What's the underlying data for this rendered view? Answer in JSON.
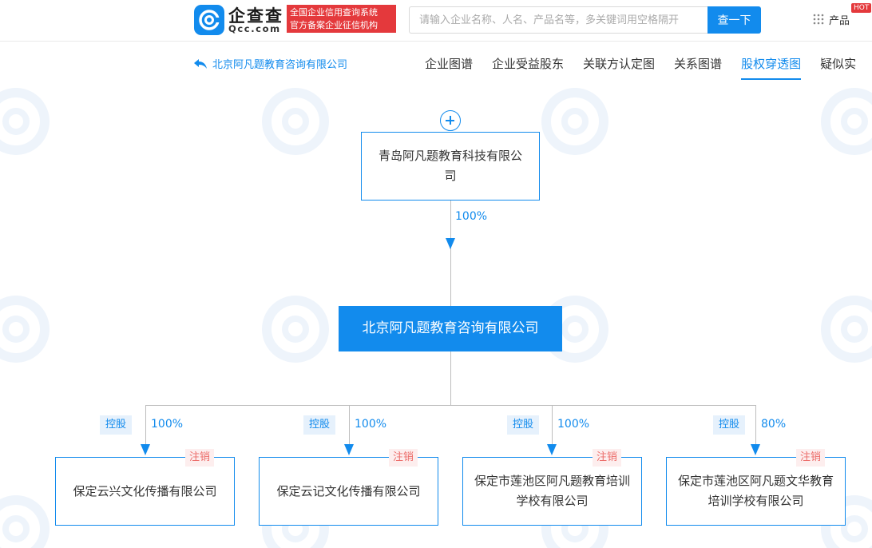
{
  "header": {
    "logo_cn": "企查查",
    "logo_en": "Qcc.com",
    "badge_line1": "全国企业信用查询系统",
    "badge_line2": "官方备案企业征信机构",
    "search_placeholder": "请输入企业名称、人名、产品名等，多关键词用空格隔开",
    "search_button": "查一下",
    "products_label": "产品",
    "hot_label": "HOT"
  },
  "nav": {
    "back_label": "北京阿凡题教育咨询有限公司",
    "tabs": [
      "企业图谱",
      "企业受益股东",
      "关联方认定图",
      "关系图谱",
      "股权穿透图",
      "疑似实"
    ]
  },
  "tree": {
    "parent": {
      "name": "青岛阿凡题教育科技有限公司",
      "pct": "100%"
    },
    "root": {
      "name": "北京阿凡题教育咨询有限公司"
    },
    "children": [
      {
        "name": "保定云兴文化传播有限公司",
        "pct": "100%",
        "type": "控股",
        "status": "注销"
      },
      {
        "name": "保定云记文化传播有限公司",
        "pct": "100%",
        "type": "控股",
        "status": "注销"
      },
      {
        "name": "保定市莲池区阿凡题教育培训学校有限公司",
        "pct": "100%",
        "type": "控股",
        "status": "注销"
      },
      {
        "name": "保定市莲池区阿凡题文华教育培训学校有限公司",
        "pct": "80%",
        "type": "控股",
        "status": "注销"
      }
    ]
  },
  "colors": {
    "accent": "#128bed",
    "red": "#e4393c",
    "cancel": "#ec6c69"
  }
}
